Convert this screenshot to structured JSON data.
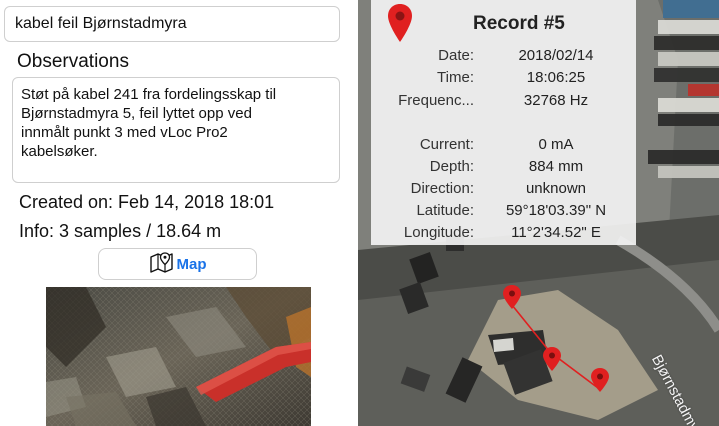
{
  "left": {
    "title_value": "kabel feil Bjørnstadmyra",
    "observations_label": "Observations",
    "observations_text": "Støt på kabel 241 fra fordelingsskap til\nBjørnstadmyra 5, feil lyttet opp ved\ninnmålt punkt 3 med vLoc Pro2\nkabelsøker.",
    "created": "Created on: Feb 14, 2018 18:01",
    "info": "Info: 3 samples / 18.64 m",
    "map_button_label": "Map",
    "map_button_icon": "map-icon",
    "accent_color": "#1a73e8"
  },
  "record": {
    "title": "Record #5",
    "pin_icon": "map-pin-icon",
    "pin_color": "#e02020",
    "fields": [
      {
        "label": "Date:",
        "value": "2018/02/14"
      },
      {
        "label": "Time:",
        "value": "18:06:25"
      },
      {
        "label": "Frequenc...",
        "value": "32768 Hz"
      },
      {
        "label": "Current:",
        "value": "0 mA"
      },
      {
        "label": "Depth:",
        "value": "884 mm"
      },
      {
        "label": "Direction:",
        "value": "unknown"
      },
      {
        "label": "Latitude:",
        "value": "59°18'03.39\" N"
      },
      {
        "label": "Longitude:",
        "value": "11°2'34.52\" E"
      }
    ]
  },
  "map": {
    "road_label": "Bjørnstadmyra",
    "route_color": "#e02020"
  }
}
